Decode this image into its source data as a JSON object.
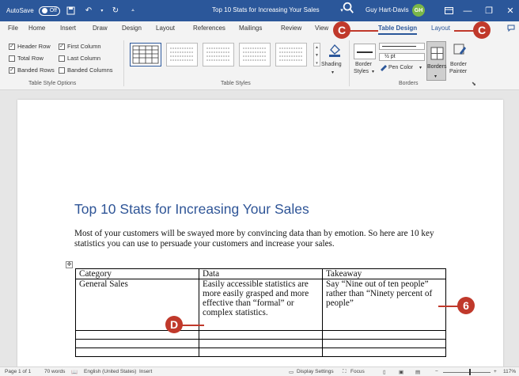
{
  "titlebar": {
    "autosave_label": "AutoSave",
    "autosave_state": "Off",
    "doc_title": "Top 10 Stats for Increasing Your Sales",
    "user_name": "Guy Hart-Davis",
    "user_initials": "GH"
  },
  "tabs": {
    "file": "File",
    "home": "Home",
    "insert": "Insert",
    "draw": "Draw",
    "design": "Design",
    "layout": "Layout",
    "references": "References",
    "mailings": "Mailings",
    "review": "Review",
    "view": "View",
    "table_design": "Table Design",
    "table_layout": "Layout"
  },
  "ribbon": {
    "style_options": {
      "header_row": "Header Row",
      "first_column": "First Column",
      "total_row": "Total Row",
      "last_column": "Last Column",
      "banded_rows": "Banded Rows",
      "banded_columns": "Banded Columns",
      "group_label": "Table Style Options"
    },
    "table_styles_label": "Table Styles",
    "shading": "Shading",
    "border_styles_line1": "Border",
    "border_styles_line2": "Styles",
    "pen_weight": "½ pt",
    "pen_color": "Pen Color",
    "borders": "Borders",
    "border_painter_line1": "Border",
    "border_painter_line2": "Painter",
    "borders_group_label": "Borders"
  },
  "document": {
    "heading": "Top 10 Stats for Increasing Your Sales",
    "paragraph": "Most of your customers will be swayed more by convincing data than by emotion. So here are 10 key statistics you can use to persuade your customers and increase your sales.",
    "table": {
      "headers": [
        "Category",
        "Data",
        "Takeaway"
      ],
      "row1": [
        "General Sales",
        "Easily accessible statistics are more easily grasped and more effective than “formal” or complex statistics.",
        "Say “Nine out of ten people” rather than “Ninety percent of people”"
      ]
    }
  },
  "callouts": {
    "c1": "C",
    "c2": "C",
    "d": "D",
    "six": "6"
  },
  "statusbar": {
    "page": "Page 1 of 1",
    "words": "70 words",
    "language": "English (United States)",
    "mode": "Insert",
    "display_settings": "Display Settings",
    "focus": "Focus",
    "zoom": "117%"
  },
  "colors": {
    "titlebar": "#2b579a",
    "accent": "#2b579a",
    "heading": "#2f5597",
    "callout": "#c0392b"
  }
}
